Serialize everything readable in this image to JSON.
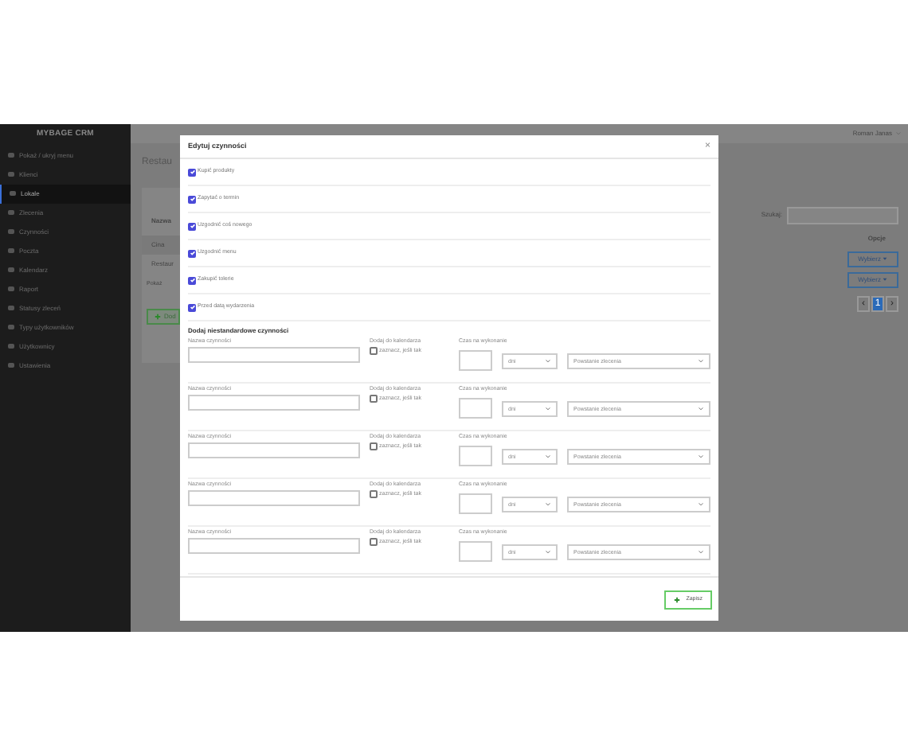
{
  "sidebar": {
    "title": "MYBAGE CRM",
    "items": [
      {
        "label": "Pokaż / ukryj menu",
        "selected": false
      },
      {
        "label": "Klienci",
        "selected": false
      },
      {
        "label": "Lokale",
        "selected": true
      },
      {
        "label": "Zlecenia",
        "selected": false
      },
      {
        "label": "Czynności",
        "selected": false
      },
      {
        "label": "Poczta",
        "selected": false
      },
      {
        "label": "Kalendarz",
        "selected": false
      },
      {
        "label": "Raport",
        "selected": false
      },
      {
        "label": "Statusy zleceń",
        "selected": false
      },
      {
        "label": "Typy użytkowników",
        "selected": false
      },
      {
        "label": "Użytkownicy",
        "selected": false
      },
      {
        "label": "Ustawienia",
        "selected": false
      }
    ]
  },
  "topbar": {
    "user": "Roman Janas"
  },
  "background_left": {
    "title": "Restau",
    "column_1": "Nazwa",
    "rows": [
      "Cina",
      "Restaur"
    ],
    "show_label": "Pokaż",
    "add_button": "Dod"
  },
  "background_right": {
    "search_label": "Szukaj:",
    "options_header": "Opcje",
    "row_buttons": [
      "Wybierz",
      "Wybierz"
    ],
    "pagination": [
      {
        "label": "‹",
        "selected": false
      },
      {
        "label": "1",
        "selected": true
      },
      {
        "label": "›",
        "selected": false
      }
    ]
  },
  "modal": {
    "title": "Edytuj czynności",
    "close": "×",
    "activities": [
      {
        "label": "Kupić produkty",
        "checked": true
      },
      {
        "label": "Zapytać o termin",
        "checked": true
      },
      {
        "label": "Uzgodnić coś nowego",
        "checked": true
      },
      {
        "label": "Uzgodnić menu",
        "checked": true
      },
      {
        "label": "Zakupić tolerie",
        "checked": true
      },
      {
        "label": "Przed datą wydarzenia",
        "checked": true
      }
    ],
    "custom_heading": "Dodaj niestandardowe czynności",
    "custom_rows": [
      {
        "name_label": "Nazwa czynności",
        "calendar_label": "Dodaj do kalendarza",
        "calendar_option": "zaznacz, jeśli tak",
        "checked": false,
        "time_label": "Czas na wykonanie",
        "unit": "dni",
        "reference": "Powstanie zlecenia"
      },
      {
        "name_label": "Nazwa czynności",
        "calendar_label": "Dodaj do kalendarza",
        "calendar_option": "zaznacz, jeśli tak",
        "checked": false,
        "time_label": "Czas na wykonanie",
        "unit": "dni",
        "reference": "Powstanie zlecenia"
      },
      {
        "name_label": "Nazwa czynności",
        "calendar_label": "Dodaj do kalendarza",
        "calendar_option": "zaznacz, jeśli tak",
        "checked": false,
        "time_label": "Czas na wykonanie",
        "unit": "dni",
        "reference": "Powstanie zlecenia"
      },
      {
        "name_label": "Nazwa czynności",
        "calendar_label": "Dodaj do kalendarza",
        "calendar_option": "zaznacz, jeśli tak",
        "checked": false,
        "time_label": "Czas na wykonanie",
        "unit": "dni",
        "reference": "Powstanie zlecenia"
      },
      {
        "name_label": "Nazwa czynności",
        "calendar_label": "Dodaj do kalendarza",
        "calendar_option": "zaznacz, jeśli tak",
        "checked": false,
        "time_label": "Czas na wykonanie",
        "unit": "dni",
        "reference": "Powstanie zlecenia"
      }
    ],
    "save_button": "Zapisz"
  }
}
